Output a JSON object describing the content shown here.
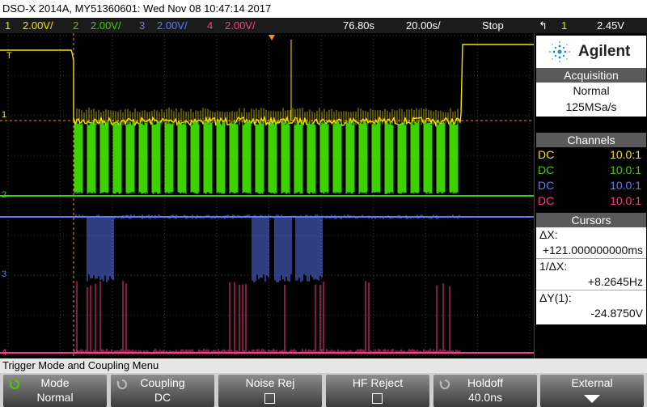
{
  "title": "DSO-X 2014A, MY51360601: Wed Nov 08 10:47:14 2017",
  "channel_bar": {
    "ch1": {
      "num": "1",
      "scale": "2.00V/"
    },
    "ch2": {
      "num": "2",
      "scale": "2.00V/"
    },
    "ch3": {
      "num": "3",
      "scale": "2.00V/"
    },
    "ch4": {
      "num": "4",
      "scale": "2.00V/"
    },
    "delay": "76.80s",
    "timebase": "20.00s/",
    "run_state": "Stop",
    "trig_slope": "↰",
    "trig_source": "1",
    "trig_level": "2.45V"
  },
  "colors": {
    "ch1": "#f5e400",
    "ch2": "#3fd000",
    "ch3": "#5b7dff",
    "ch4": "#ff3a8c",
    "trigger": "#ff8c1a"
  },
  "markers": {
    "trig": "T",
    "ch1": "1",
    "ch2": "2",
    "ch3": "3",
    "ch4": "4"
  },
  "panel": {
    "brand": "Agilent",
    "acquisition": {
      "header": "Acquisition",
      "mode": "Normal",
      "rate": "125MSa/s"
    },
    "channels": {
      "header": "Channels",
      "rows": [
        {
          "coupling": "DC",
          "probe": "10.0:1"
        },
        {
          "coupling": "DC",
          "probe": "10.0:1"
        },
        {
          "coupling": "DC",
          "probe": "10.0:1"
        },
        {
          "coupling": "DC",
          "probe": "10.0:1"
        }
      ]
    },
    "cursors": {
      "header": "Cursors",
      "dx_label": "ΔX:",
      "dx_value": "+121.000000000ms",
      "inv_label": "1/ΔX:",
      "inv_value": "+8.2645Hz",
      "dy_label": "ΔY(1):",
      "dy_value": "-24.8750V"
    }
  },
  "status": "Trigger Mode and Coupling Menu",
  "softkeys": [
    {
      "top": "Mode",
      "bottom": "Normal"
    },
    {
      "top": "Coupling",
      "bottom": "DC"
    },
    {
      "top": "Noise Rej",
      "bottom": ""
    },
    {
      "top": "HF Reject",
      "bottom": ""
    },
    {
      "top": "Holdoff",
      "bottom": "40.0ns"
    },
    {
      "top": "External",
      "bottom": ""
    }
  ]
}
